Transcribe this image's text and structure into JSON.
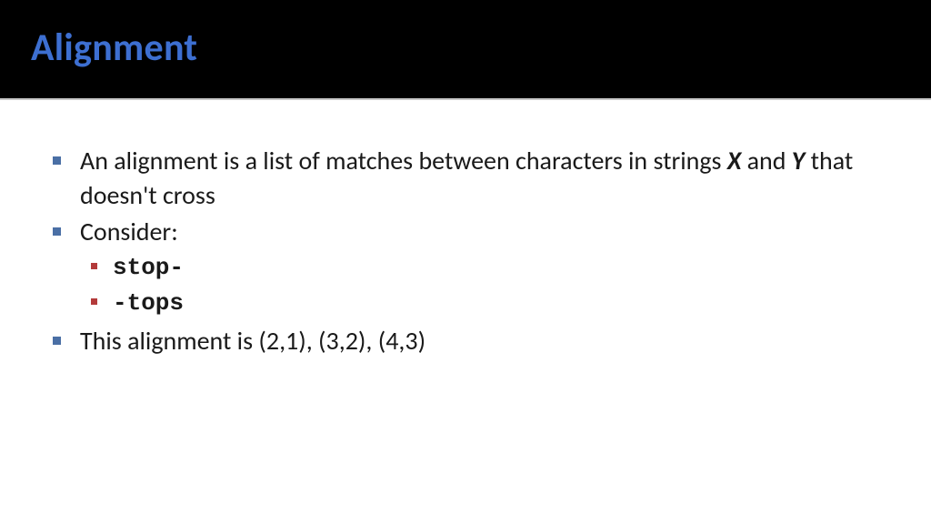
{
  "header": {
    "title": "Alignment"
  },
  "bullets": {
    "b1": {
      "prefix": "An alignment is a list of matches between characters in strings ",
      "x": "X",
      "mid": " and ",
      "y": "Y",
      "suffix": " that doesn't cross"
    },
    "b2": "Consider:",
    "sub": {
      "s1": "stop-",
      "s2": "-tops"
    },
    "b3": "This alignment is (2,1), (3,2), (4,3)"
  }
}
